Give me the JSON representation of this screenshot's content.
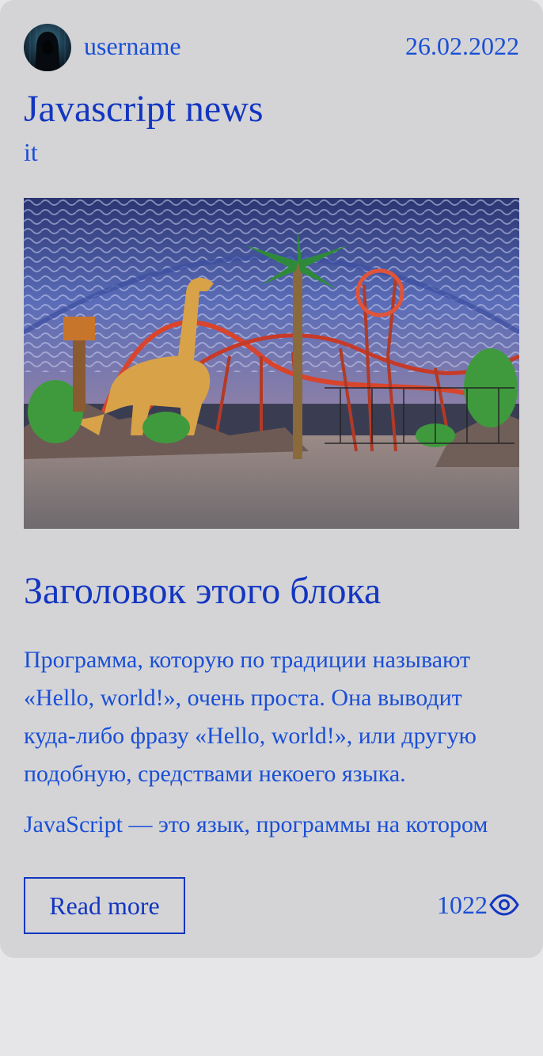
{
  "post": {
    "author": {
      "username": "username",
      "avatar_icon": "hooded-figure-avatar"
    },
    "date": "26.02.2022",
    "title": "Javascript news",
    "category": "it",
    "image": {
      "description_icon": "theme-park-dinosaur-photo"
    },
    "block_heading": "Заголовок этого блока",
    "paragraphs": [
      "Программа, которую по традиции называют «Hello, world!», очень проста. Она выводит куда-либо фразу «Hello, world!», или другую подобную, средствами некоего языка.",
      "JavaScript — это язык, программы на котором"
    ],
    "read_more_label": "Read more",
    "views": "1022",
    "views_icon": "eye-icon"
  },
  "colors": {
    "accent": "#1a4fd6",
    "heading": "#1336c0",
    "card_bg": "#d4d4d7",
    "page_bg": "#e6e6e8"
  }
}
